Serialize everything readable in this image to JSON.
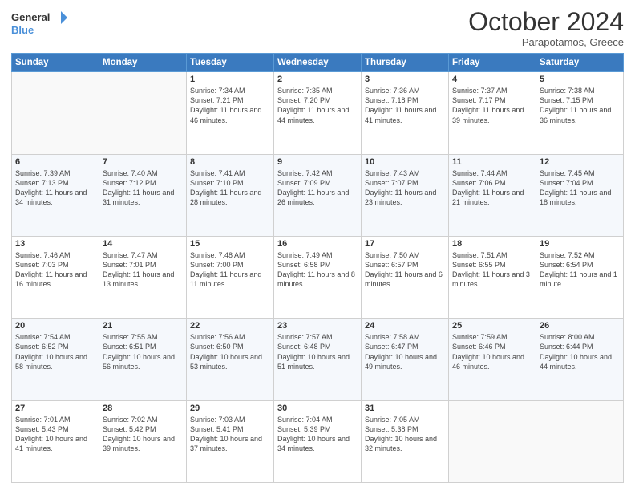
{
  "header": {
    "logo_line1": "General",
    "logo_line2": "Blue",
    "month": "October 2024",
    "location": "Parapotamos, Greece"
  },
  "days_of_week": [
    "Sunday",
    "Monday",
    "Tuesday",
    "Wednesday",
    "Thursday",
    "Friday",
    "Saturday"
  ],
  "weeks": [
    [
      {
        "day": "",
        "info": ""
      },
      {
        "day": "",
        "info": ""
      },
      {
        "day": "1",
        "info": "Sunrise: 7:34 AM\nSunset: 7:21 PM\nDaylight: 11 hours and 46 minutes."
      },
      {
        "day": "2",
        "info": "Sunrise: 7:35 AM\nSunset: 7:20 PM\nDaylight: 11 hours and 44 minutes."
      },
      {
        "day": "3",
        "info": "Sunrise: 7:36 AM\nSunset: 7:18 PM\nDaylight: 11 hours and 41 minutes."
      },
      {
        "day": "4",
        "info": "Sunrise: 7:37 AM\nSunset: 7:17 PM\nDaylight: 11 hours and 39 minutes."
      },
      {
        "day": "5",
        "info": "Sunrise: 7:38 AM\nSunset: 7:15 PM\nDaylight: 11 hours and 36 minutes."
      }
    ],
    [
      {
        "day": "6",
        "info": "Sunrise: 7:39 AM\nSunset: 7:13 PM\nDaylight: 11 hours and 34 minutes."
      },
      {
        "day": "7",
        "info": "Sunrise: 7:40 AM\nSunset: 7:12 PM\nDaylight: 11 hours and 31 minutes."
      },
      {
        "day": "8",
        "info": "Sunrise: 7:41 AM\nSunset: 7:10 PM\nDaylight: 11 hours and 28 minutes."
      },
      {
        "day": "9",
        "info": "Sunrise: 7:42 AM\nSunset: 7:09 PM\nDaylight: 11 hours and 26 minutes."
      },
      {
        "day": "10",
        "info": "Sunrise: 7:43 AM\nSunset: 7:07 PM\nDaylight: 11 hours and 23 minutes."
      },
      {
        "day": "11",
        "info": "Sunrise: 7:44 AM\nSunset: 7:06 PM\nDaylight: 11 hours and 21 minutes."
      },
      {
        "day": "12",
        "info": "Sunrise: 7:45 AM\nSunset: 7:04 PM\nDaylight: 11 hours and 18 minutes."
      }
    ],
    [
      {
        "day": "13",
        "info": "Sunrise: 7:46 AM\nSunset: 7:03 PM\nDaylight: 11 hours and 16 minutes."
      },
      {
        "day": "14",
        "info": "Sunrise: 7:47 AM\nSunset: 7:01 PM\nDaylight: 11 hours and 13 minutes."
      },
      {
        "day": "15",
        "info": "Sunrise: 7:48 AM\nSunset: 7:00 PM\nDaylight: 11 hours and 11 minutes."
      },
      {
        "day": "16",
        "info": "Sunrise: 7:49 AM\nSunset: 6:58 PM\nDaylight: 11 hours and 8 minutes."
      },
      {
        "day": "17",
        "info": "Sunrise: 7:50 AM\nSunset: 6:57 PM\nDaylight: 11 hours and 6 minutes."
      },
      {
        "day": "18",
        "info": "Sunrise: 7:51 AM\nSunset: 6:55 PM\nDaylight: 11 hours and 3 minutes."
      },
      {
        "day": "19",
        "info": "Sunrise: 7:52 AM\nSunset: 6:54 PM\nDaylight: 11 hours and 1 minute."
      }
    ],
    [
      {
        "day": "20",
        "info": "Sunrise: 7:54 AM\nSunset: 6:52 PM\nDaylight: 10 hours and 58 minutes."
      },
      {
        "day": "21",
        "info": "Sunrise: 7:55 AM\nSunset: 6:51 PM\nDaylight: 10 hours and 56 minutes."
      },
      {
        "day": "22",
        "info": "Sunrise: 7:56 AM\nSunset: 6:50 PM\nDaylight: 10 hours and 53 minutes."
      },
      {
        "day": "23",
        "info": "Sunrise: 7:57 AM\nSunset: 6:48 PM\nDaylight: 10 hours and 51 minutes."
      },
      {
        "day": "24",
        "info": "Sunrise: 7:58 AM\nSunset: 6:47 PM\nDaylight: 10 hours and 49 minutes."
      },
      {
        "day": "25",
        "info": "Sunrise: 7:59 AM\nSunset: 6:46 PM\nDaylight: 10 hours and 46 minutes."
      },
      {
        "day": "26",
        "info": "Sunrise: 8:00 AM\nSunset: 6:44 PM\nDaylight: 10 hours and 44 minutes."
      }
    ],
    [
      {
        "day": "27",
        "info": "Sunrise: 7:01 AM\nSunset: 5:43 PM\nDaylight: 10 hours and 41 minutes."
      },
      {
        "day": "28",
        "info": "Sunrise: 7:02 AM\nSunset: 5:42 PM\nDaylight: 10 hours and 39 minutes."
      },
      {
        "day": "29",
        "info": "Sunrise: 7:03 AM\nSunset: 5:41 PM\nDaylight: 10 hours and 37 minutes."
      },
      {
        "day": "30",
        "info": "Sunrise: 7:04 AM\nSunset: 5:39 PM\nDaylight: 10 hours and 34 minutes."
      },
      {
        "day": "31",
        "info": "Sunrise: 7:05 AM\nSunset: 5:38 PM\nDaylight: 10 hours and 32 minutes."
      },
      {
        "day": "",
        "info": ""
      },
      {
        "day": "",
        "info": ""
      }
    ]
  ]
}
